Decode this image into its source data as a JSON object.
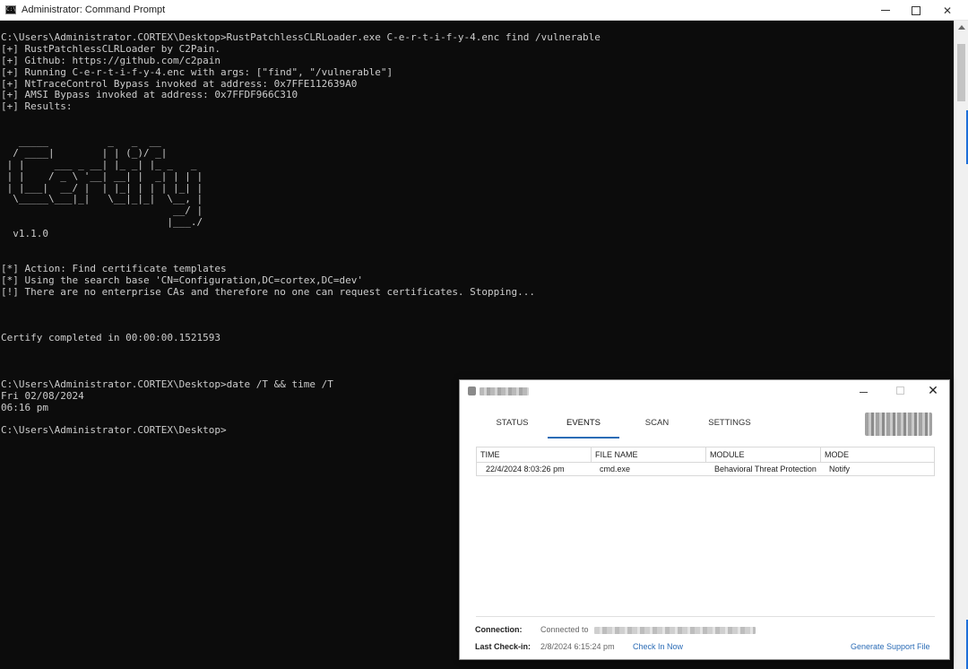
{
  "cmd": {
    "title": "Administrator: Command Prompt",
    "icon": "cmd-console-icon",
    "lines": [
      "C:\\Users\\Administrator.CORTEX\\Desktop>RustPatchlessCLRLoader.exe C-e-r-t-i-f-y-4.enc find /vulnerable",
      "[+] RustPatchlessCLRLoader by C2Pain.",
      "[+] Github: https://github.com/c2pain",
      "[+] Running C-e-r-t-i-f-y-4.enc with args: [\"find\", \"/vulnerable\"]",
      "[+] NtTraceControl Bypass invoked at address: 0x7FFE112639A0",
      "[+] AMSI Bypass invoked at address: 0x7FFDF966C310",
      "[+] Results:",
      "",
      "",
      "   _____          _   _  __",
      "  / ____|        | | (_)/ _|",
      " | |     ___ _ __| |_ _| |_ _   _",
      " | |    / _ \\ '__| __| |  _| | | |",
      " | |___|  __/ |  | |_| | | | |_| |",
      "  \\_____\\___|_|   \\__|_|_|  \\__, |",
      "                             __/ |",
      "                            |___./",
      "  v1.1.0",
      "",
      "",
      "[*] Action: Find certificate templates",
      "[*] Using the search base 'CN=Configuration,DC=cortex,DC=dev'",
      "[!] There are no enterprise CAs and therefore no one can request certificates. Stopping...",
      "",
      "",
      "",
      "Certify completed in 00:00:00.1521593",
      "",
      "",
      "",
      "C:\\Users\\Administrator.CORTEX\\Desktop>date /T && time /T",
      "Fri 02/08/2024",
      "06:16 pm",
      "",
      "C:\\Users\\Administrator.CORTEX\\Desktop>"
    ]
  },
  "agent": {
    "tabs": {
      "status": "STATUS",
      "events": "EVENTS",
      "scan": "SCAN",
      "settings": "SETTINGS"
    },
    "close_glyph": "✕",
    "table": {
      "headers": [
        "TIME",
        "FILE NAME",
        "MODULE",
        "MODE"
      ],
      "rows": [
        [
          "22/4/2024 8:03:26 pm",
          "cmd.exe",
          "Behavioral Threat Protection",
          "Notify"
        ]
      ]
    },
    "footer": {
      "connection_label": "Connection:",
      "connection_value": "Connected to",
      "checkin_label": "Last Check-in:",
      "checkin_value": "2/8/2024 6:15:24 pm",
      "check_in_now": "Check In Now",
      "generate_support": "Generate Support File"
    }
  }
}
